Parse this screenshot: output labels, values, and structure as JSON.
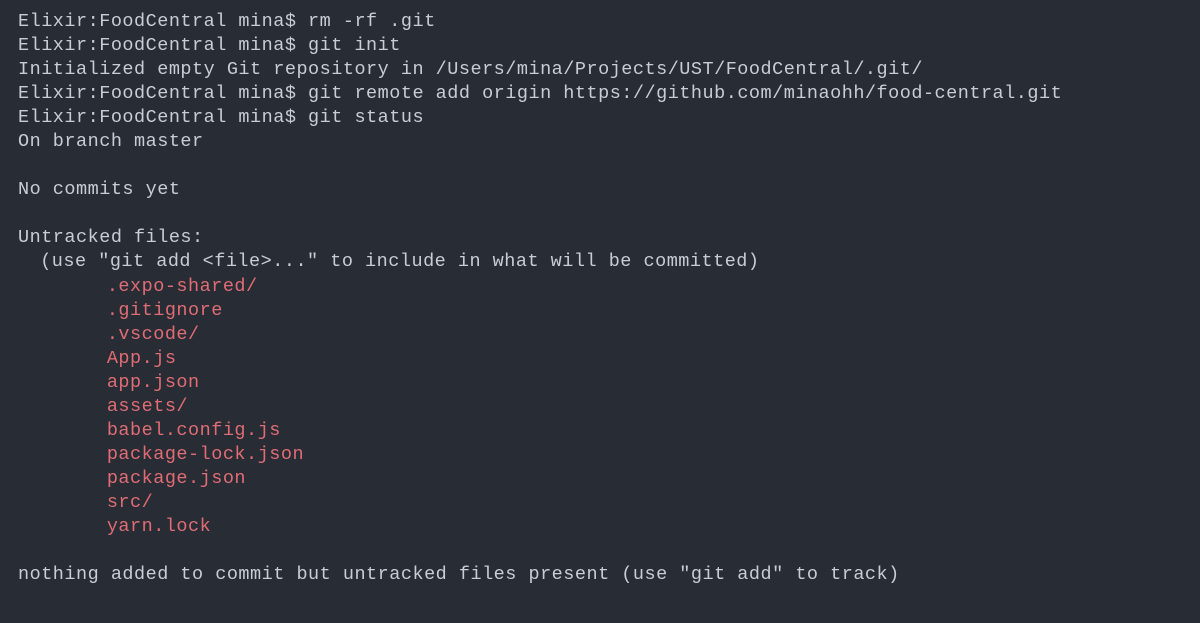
{
  "prompt": "Elixir:FoodCentral mina$ ",
  "commands": {
    "rm": "rm -rf .git",
    "init": "git init",
    "remote": "git remote add origin https://github.com/minaohh/food-central.git",
    "status": "git status"
  },
  "output": {
    "init_msg": "Initialized empty Git repository in /Users/mina/Projects/UST/FoodCentral/.git/",
    "branch": "On branch master",
    "no_commits": "No commits yet",
    "untracked_header": "Untracked files:",
    "untracked_hint": "(use \"git add <file>...\" to include in what will be committed)",
    "footer": "nothing added to commit but untracked files present (use \"git add\" to track)"
  },
  "untracked_files": [
    ".expo-shared/",
    ".gitignore",
    ".vscode/",
    "App.js",
    "app.json",
    "assets/",
    "babel.config.js",
    "package-lock.json",
    "package.json",
    "src/",
    "yarn.lock"
  ]
}
